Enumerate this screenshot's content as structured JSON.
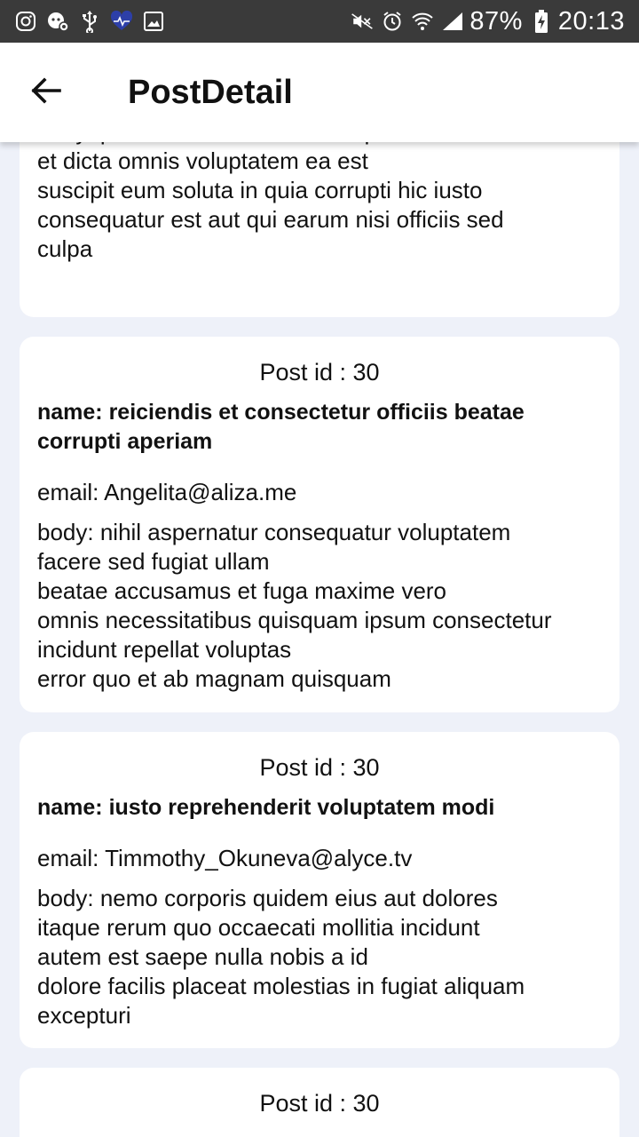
{
  "status_bar": {
    "battery": "87%",
    "time": "20:13"
  },
  "header": {
    "title": "PostDetail"
  },
  "posts": [
    {
      "body": "body: possimus necessitatibus quis\net dicta omnis voluptatem ea est\nsuscipit eum soluta in quia corrupti hic iusto\nconsequatur est aut qui earum nisi officiis sed\nculpa"
    },
    {
      "post_id": "Post id : 30",
      "name": "name: reiciendis et consectetur officiis beatae corrupti aperiam",
      "email": "email: Angelita@aliza.me",
      "body": "body: nihil aspernatur consequatur voluptatem\nfacere sed fugiat ullam\nbeatae accusamus et fuga maxime vero\nomnis necessitatibus quisquam ipsum consectetur\nincidunt repellat voluptas\nerror quo et ab magnam quisquam"
    },
    {
      "post_id": "Post id : 30",
      "name": "name: iusto reprehenderit voluptatem modi",
      "email": "email: Timmothy_Okuneva@alyce.tv",
      "body": "body: nemo corporis quidem eius aut dolores\nitaque rerum quo occaecati mollitia incidunt\nautem est saepe nulla nobis a id\ndolore facilis placeat molestias in fugiat aliquam\nexcepturi"
    },
    {
      "post_id": "Post id : 30"
    }
  ],
  "icons": {
    "status_left": [
      "instagram-icon",
      "notification-icon",
      "usb-icon",
      "health-icon",
      "gallery-icon"
    ],
    "status_right": [
      "mute-icon",
      "alarm-icon",
      "wifi-icon",
      "signal-icon",
      "battery-charging-icon"
    ],
    "nav": "arrow-left-icon"
  },
  "colors": {
    "status_bar": "#3A3A3A",
    "app_bar": "#FFFFFF",
    "background": "#EEF1F9",
    "card": "#FFFFFF",
    "text": "#111111"
  }
}
